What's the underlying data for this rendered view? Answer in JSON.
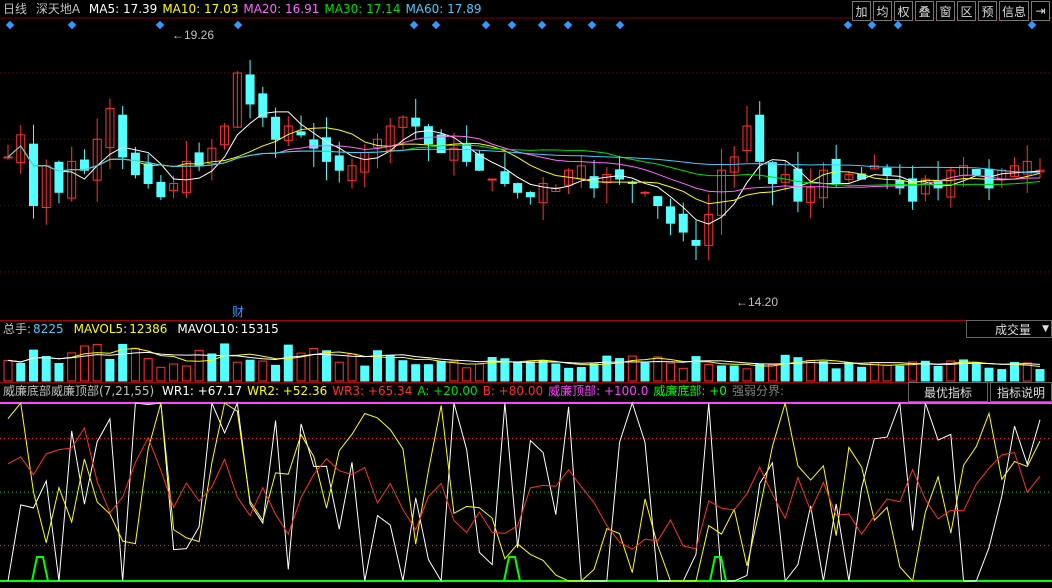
{
  "header": {
    "period": "日线",
    "stock_name": "深天地A",
    "ma": [
      {
        "label": "MA5:",
        "value": "17.39",
        "color": "#ffffff"
      },
      {
        "label": "MA10:",
        "value": "17.03",
        "color": "#ffff00"
      },
      {
        "label": "MA20:",
        "value": "16.91",
        "color": "#ff66ff"
      },
      {
        "label": "MA30:",
        "value": "17.14",
        "color": "#00e000"
      },
      {
        "label": "MA60:",
        "value": "17.89",
        "color": "#44ccff"
      }
    ],
    "toolbar": [
      "加",
      "均",
      "权",
      "叠",
      "窗",
      "区",
      "预",
      "信息"
    ],
    "high_label": "19.26",
    "low_label": "14.20",
    "cai_label": "财"
  },
  "volume": {
    "legend": [
      {
        "label": "总手:",
        "value": "8225",
        "color": "#c0c0c0",
        "vcolor": "#44ccff"
      },
      {
        "label": "MAVOL5:",
        "value": "12386",
        "color": "#ffff00",
        "vcolor": "#ffff00"
      },
      {
        "label": "MAVOL10:",
        "value": "15315",
        "color": "#ffffff",
        "vcolor": "#ffffff"
      }
    ],
    "dropdown": "成交量"
  },
  "indicator": {
    "title": "威廉底部威廉顶部(7,21,55)",
    "items": [
      {
        "label": "WR1:",
        "value": "+67.17",
        "color": "#ffffff"
      },
      {
        "label": "WR2:",
        "value": "+52.36",
        "color": "#ffff00"
      },
      {
        "label": "WR3:",
        "value": "+65.34",
        "color": "#ff3030"
      },
      {
        "label": "A:",
        "value": "+20.00",
        "color": "#00e000"
      },
      {
        "label": "B:",
        "value": "+80.00",
        "color": "#ff3030"
      },
      {
        "label": "威廉顶部:",
        "value": "+100.0",
        "color": "#ff44ff"
      },
      {
        "label": "威廉底部:",
        "value": "+0",
        "color": "#00ff00"
      }
    ],
    "extra": "强弱分界:",
    "btn_best": "最优指标",
    "btn_help": "指标说明"
  },
  "chart_data": [
    {
      "type": "candlestick",
      "title": "深天地A 日线",
      "ylim": [
        13.5,
        20.2
      ],
      "marked_high": 19.26,
      "marked_low": 14.2,
      "close_approx": [
        17.1,
        17.6,
        16.0,
        16.9,
        16.3,
        17.0,
        16.8,
        17.5,
        18.2,
        17.1,
        16.7,
        16.5,
        16.2,
        16.5,
        17.0,
        16.9,
        17.3,
        17.8,
        19.0,
        18.3,
        18.0,
        17.5,
        17.8,
        17.6,
        17.3,
        17.0,
        16.8,
        16.9,
        17.2,
        17.5,
        17.8,
        18.0,
        17.8,
        17.4,
        17.2,
        17.3,
        17.0,
        16.8,
        16.6,
        16.5,
        16.3,
        16.2,
        16.5,
        16.4,
        16.8,
        16.9,
        16.4,
        16.7,
        16.6,
        16.5,
        16.3,
        16.0,
        15.6,
        15.4,
        15.1,
        15.8,
        16.8,
        17.1,
        17.8,
        17.0,
        16.5,
        16.7,
        16.1,
        16.4,
        16.8,
        16.5,
        16.7,
        16.6,
        16.9,
        16.7,
        16.4,
        16.1,
        16.6,
        16.4,
        16.8,
        16.9,
        16.7,
        16.4,
        16.8,
        16.9,
        17.0,
        16.8
      ]
    },
    {
      "type": "bar",
      "title": "成交量",
      "series": [
        {
          "name": "总手",
          "values_approx": "relative heights only"
        }
      ]
    },
    {
      "type": "line",
      "title": "威廉底部威廉顶部(7,21,55)",
      "ylim": [
        0,
        100
      ],
      "series": [
        {
          "name": "WR1",
          "last": 67.17
        },
        {
          "name": "WR2",
          "last": 52.36
        },
        {
          "name": "WR3",
          "last": 65.34
        },
        {
          "name": "A",
          "value": 20.0
        },
        {
          "name": "B",
          "value": 80.0
        },
        {
          "name": "威廉顶部",
          "value": 100.0
        },
        {
          "name": "威廉底部",
          "value": 0
        }
      ]
    }
  ]
}
